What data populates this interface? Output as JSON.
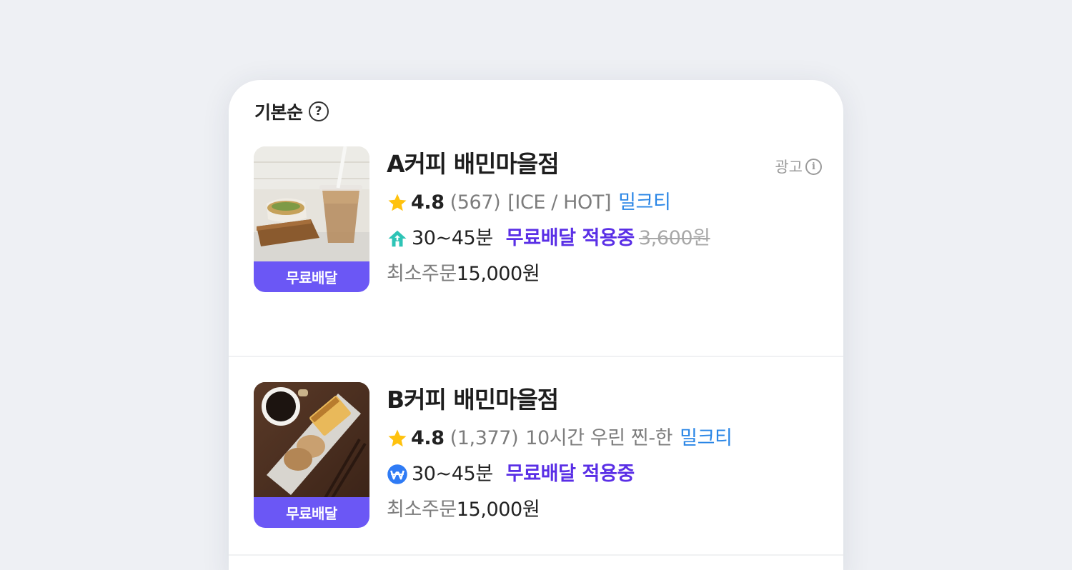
{
  "sort": {
    "label": "기본순",
    "help_icon": "?"
  },
  "stores": [
    {
      "name": "A커피 배민마을점",
      "ad_label": "광고",
      "ad_info_icon": "i",
      "rating": "4.8",
      "review_count": "(567)",
      "description": "[ICE / HOT]",
      "highlight": "밀크티",
      "eta": "30~45분",
      "free_delivery": "무료배달 적용중",
      "original_fee": "3,600원",
      "min_order_label": "최소주문",
      "min_order_value": "15,000원",
      "badge": "무료배달",
      "delivery_icon": "house-delivery-icon"
    },
    {
      "name": "B커피 배민마을점",
      "rating": "4.8",
      "review_count": "(1,377)",
      "description": "10시간 우린 찐-한",
      "highlight": "밀크티",
      "eta": "30~45분",
      "free_delivery": "무료배달 적용중",
      "min_order_label": "최소주문",
      "min_order_value": "15,000원",
      "badge": "무료배달",
      "delivery_icon": "won-coin-icon"
    }
  ],
  "colors": {
    "free_badge": "#6b57f5",
    "free_text": "#5a2fe6",
    "highlight": "#2a86e6",
    "star": "#ffc20e",
    "house_icon": "#2ec4b6"
  }
}
